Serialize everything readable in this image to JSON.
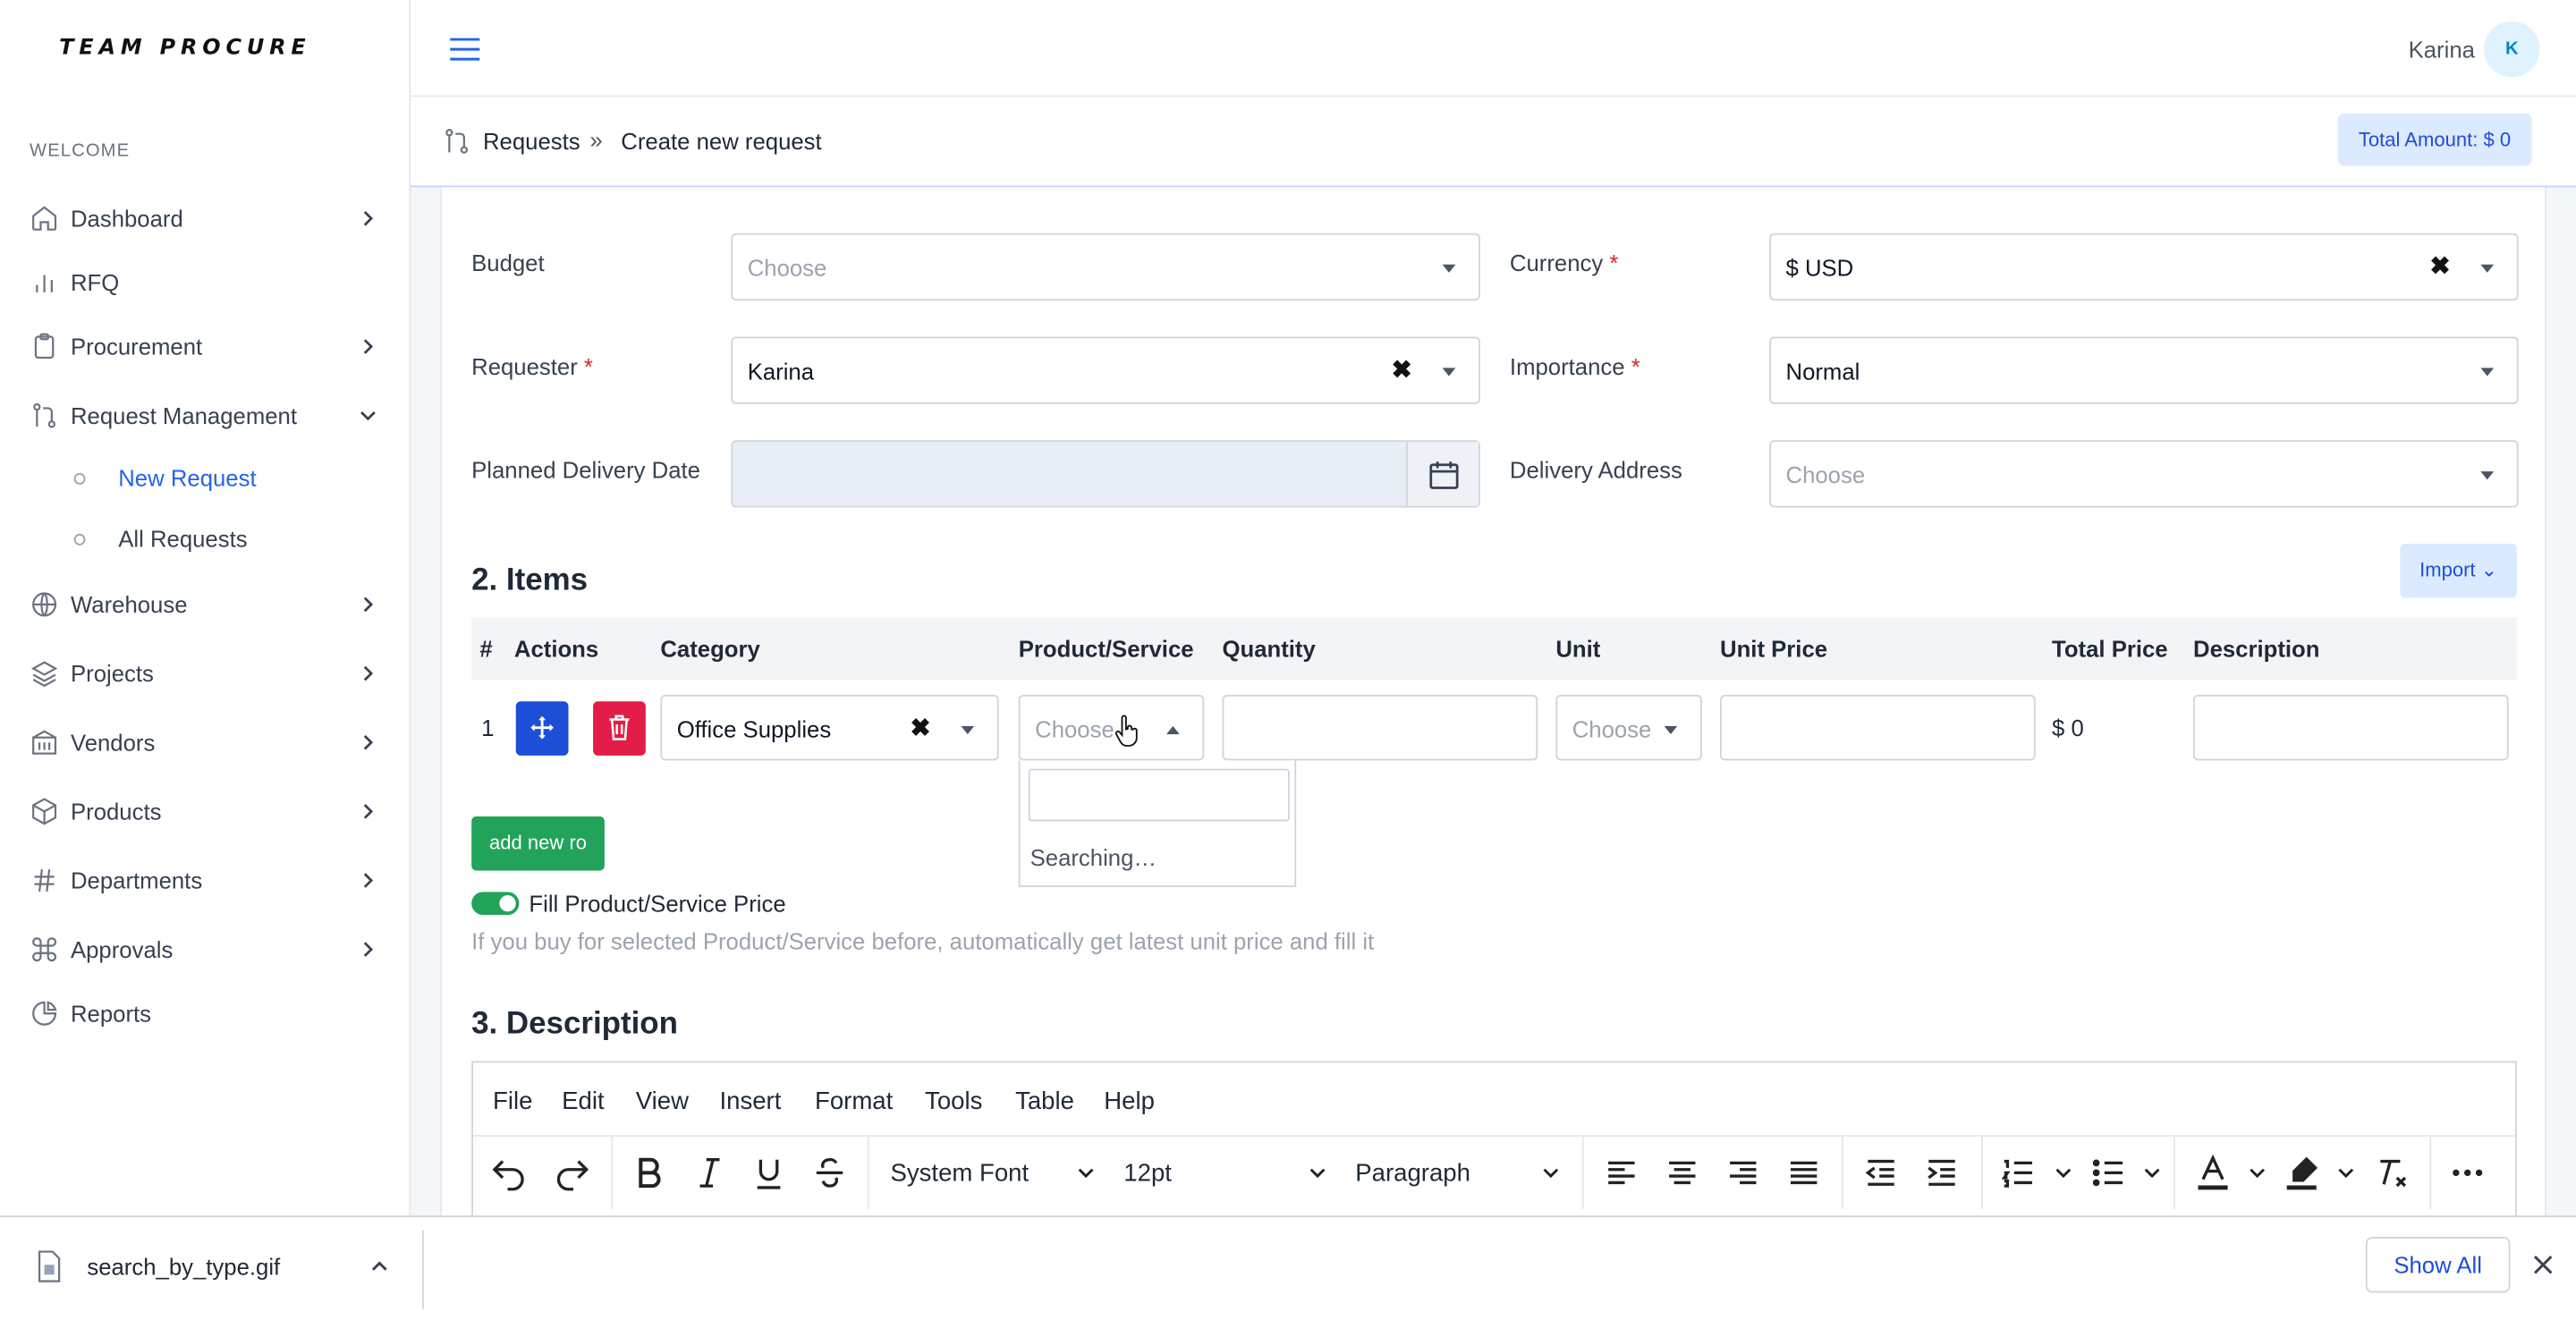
{
  "app": {
    "logo": "TEAM PROCURE"
  },
  "sidebar": {
    "section_label": "WELCOME",
    "items": [
      {
        "label": "Dashboard",
        "icon": "home-icon"
      },
      {
        "label": "RFQ",
        "icon": "bar-chart-icon"
      },
      {
        "label": "Procurement",
        "icon": "clipboard-icon"
      },
      {
        "label": "Request Management",
        "icon": "git-pull-request-icon"
      },
      {
        "label": "Warehouse",
        "icon": "globe-icon"
      },
      {
        "label": "Projects",
        "icon": "layers-icon"
      },
      {
        "label": "Vendors",
        "icon": "building-icon"
      },
      {
        "label": "Products",
        "icon": "package-icon"
      },
      {
        "label": "Departments",
        "icon": "hash-icon"
      },
      {
        "label": "Approvals",
        "icon": "command-icon"
      },
      {
        "label": "Reports",
        "icon": "pie-chart-icon"
      }
    ],
    "subitems": [
      {
        "label": "New Request",
        "active": true
      },
      {
        "label": "All Requests",
        "active": false
      }
    ]
  },
  "header": {
    "username": "Karina",
    "avatar_initial": "K"
  },
  "breadcrumb": {
    "parent": "Requests",
    "separator": "»",
    "current": "Create new request",
    "total": "Total Amount: $ 0"
  },
  "form": {
    "budget": {
      "label": "Budget",
      "placeholder": "Choose"
    },
    "currency": {
      "label": "Currency",
      "required": "*",
      "value": "$ USD"
    },
    "requester": {
      "label": "Requester",
      "required": "*",
      "value": "Karina"
    },
    "importance": {
      "label": "Importance",
      "required": "*",
      "value": "Normal"
    },
    "delivery_date": {
      "label": "Planned Delivery Date",
      "value": ""
    },
    "delivery_address": {
      "label": "Delivery Address",
      "placeholder": "Choose"
    }
  },
  "items": {
    "title": "2. Items",
    "import_label": "Import",
    "columns": [
      "#",
      "Actions",
      "Category",
      "Product/Service",
      "Quantity",
      "Unit",
      "Unit Price",
      "Total Price",
      "Description"
    ],
    "rows": [
      {
        "index": "1",
        "category": "Office Supplies",
        "product_placeholder": "Choose",
        "quantity": "",
        "unit_placeholder": "Choose",
        "unit_price": "",
        "total_price": "$ 0",
        "description": ""
      }
    ],
    "dropdown_status": "Searching…",
    "add_row_label": "add new ro",
    "fill_price_label": "Fill Product/Service Price",
    "fill_price_hint": "If you buy for selected Product/Service before, automatically get latest unit price and fill it",
    "fill_price_enabled": true
  },
  "description": {
    "title": "3. Description",
    "menu": [
      "File",
      "Edit",
      "View",
      "Insert",
      "Format",
      "Tools",
      "Table",
      "Help"
    ],
    "font": "System Font",
    "size": "12pt",
    "block": "Paragraph"
  },
  "downloads": {
    "filename": "search_by_type.gif",
    "show_all": "Show All"
  },
  "colors": {
    "primary": "#2563eb",
    "success": "#22a35a",
    "danger": "#e11d48",
    "required": "#dc2626"
  }
}
